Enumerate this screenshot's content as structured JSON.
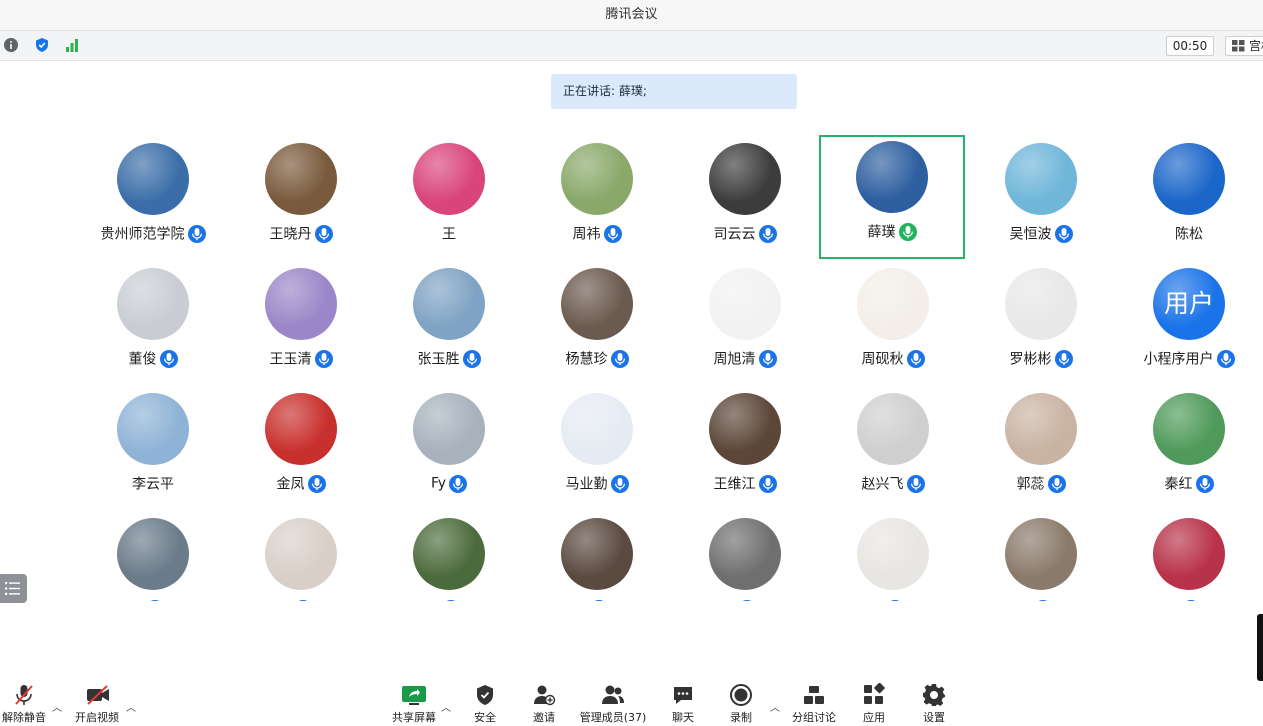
{
  "window": {
    "title": "腾讯会议"
  },
  "infobar": {
    "timer": "00:50",
    "layout_label": "宫格"
  },
  "speaking": {
    "label": "正在讲话:",
    "name": "薛璞;"
  },
  "participants": [
    {
      "name": "贵州师范学院",
      "mic": "blue",
      "bg": "#3b6ea8"
    },
    {
      "name": "王晓丹",
      "mic": "blue",
      "bg": "#7a5a3c"
    },
    {
      "name": "王",
      "mic": "",
      "bg": "#d9457a"
    },
    {
      "name": "周祎",
      "mic": "blue",
      "bg": "#8aa86a"
    },
    {
      "name": "司云云",
      "mic": "blue",
      "bg": "#3c3c3c"
    },
    {
      "name": "薛璞",
      "mic": "green",
      "bg": "#2e5fa0"
    },
    {
      "name": "吴恒波",
      "mic": "blue",
      "bg": "#6fb6d9"
    },
    {
      "name": "陈松",
      "mic": "",
      "bg": "#1b66c9"
    },
    {
      "name": "董俊",
      "mic": "blue",
      "bg": "#c9cdd3"
    },
    {
      "name": "王玉清",
      "mic": "blue",
      "bg": "#9a86c8"
    },
    {
      "name": "张玉胜",
      "mic": "blue",
      "bg": "#7fa3c4"
    },
    {
      "name": "杨慧珍",
      "mic": "blue",
      "bg": "#6b5a4f"
    },
    {
      "name": "周旭清",
      "mic": "blue",
      "bg": "#f2f2f2"
    },
    {
      "name": "周砚秋",
      "mic": "blue",
      "bg": "#f3eee9"
    },
    {
      "name": "罗彬彬",
      "mic": "blue",
      "bg": "#e8e8e8"
    },
    {
      "name": "小程序用户",
      "mic": "blue",
      "bg": "#1a73e8",
      "text": "用户"
    },
    {
      "name": "李云平",
      "mic": "",
      "bg": "#8fb3d6"
    },
    {
      "name": "金凤",
      "mic": "blue",
      "bg": "#c8302d"
    },
    {
      "name": "Fy",
      "mic": "blue",
      "bg": "#a7b2bd"
    },
    {
      "name": "马业勤",
      "mic": "blue",
      "bg": "#e6ebf3"
    },
    {
      "name": "王维江",
      "mic": "blue",
      "bg": "#5b4638"
    },
    {
      "name": "赵兴飞",
      "mic": "blue",
      "bg": "#cfcfcf"
    },
    {
      "name": "郭蕊",
      "mic": "blue",
      "bg": "#c9b3a3"
    },
    {
      "name": "秦红",
      "mic": "blue",
      "bg": "#4f9a5a"
    },
    {
      "name": "",
      "mic": "blue",
      "bg": "#6a7b8a"
    },
    {
      "name": "",
      "mic": "blue",
      "bg": "#d9cfc8"
    },
    {
      "name": "",
      "mic": "blue",
      "bg": "#4c6b3c"
    },
    {
      "name": "",
      "mic": "blue",
      "bg": "#5a4a40"
    },
    {
      "name": "",
      "mic": "blue",
      "bg": "#6f6f6f"
    },
    {
      "name": "",
      "mic": "blue",
      "bg": "#e8e6e2"
    },
    {
      "name": "",
      "mic": "blue",
      "bg": "#8a7a6b"
    },
    {
      "name": "",
      "mic": "blue",
      "bg": "#b8324a"
    }
  ],
  "toolbar": {
    "unmute": "解除静音",
    "start_video": "开启视频",
    "share_screen": "共享屏幕",
    "security": "安全",
    "invite": "邀请",
    "manage_members": "管理成员(37)",
    "chat": "聊天",
    "record": "录制",
    "breakout": "分组讨论",
    "apps": "应用",
    "settings": "设置"
  }
}
